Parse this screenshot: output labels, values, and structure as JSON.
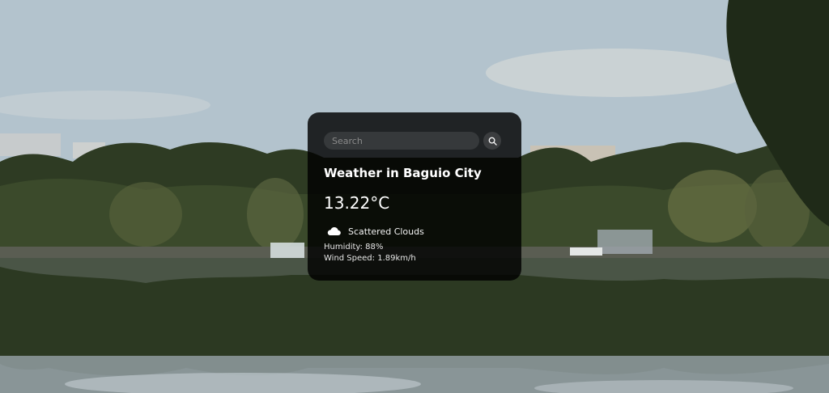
{
  "weather": {
    "search_placeholder": "Search",
    "title": "Weather in Baguio City",
    "temperature": "13.22°C",
    "description": "Scattered Clouds",
    "humidity": "Humidity: 88%",
    "wind": "Wind Speed: 1.89km/h",
    "icons": {
      "search": "search-icon",
      "condition": "cloud-icon"
    }
  }
}
